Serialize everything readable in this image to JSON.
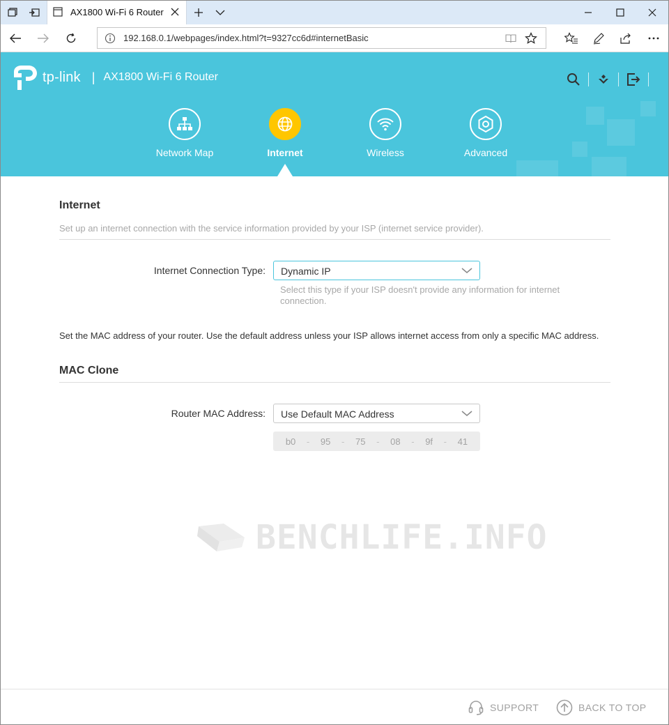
{
  "browser": {
    "tab_title": "AX1800 Wi-Fi 6 Router",
    "url": "192.168.0.1/webpages/index.html?t=9327cc6d#internetBasic"
  },
  "header": {
    "brand": "tp-link",
    "separator": "|",
    "model": "AX1800 Wi-Fi 6 Router",
    "accent_color": "#4ac5dc",
    "active_color": "#ffc600"
  },
  "nav": {
    "items": [
      {
        "label": "Network Map",
        "icon": "network-map-icon"
      },
      {
        "label": "Internet",
        "icon": "globe-icon",
        "active": true
      },
      {
        "label": "Wireless",
        "icon": "wifi-icon"
      },
      {
        "label": "Advanced",
        "icon": "gear-icon"
      }
    ]
  },
  "internet": {
    "title": "Internet",
    "description": "Set up an internet connection with the service information provided by your ISP (internet service provider).",
    "connection_type_label": "Internet Connection Type:",
    "connection_type_value": "Dynamic IP",
    "connection_type_hint": "Select this type if your ISP doesn't provide any information for internet connection."
  },
  "mac_clone": {
    "intro": "Set the MAC address of your router. Use the default address unless your ISP allows internet access from only a specific MAC address.",
    "title": "MAC Clone",
    "router_mac_label": "Router MAC Address:",
    "router_mac_value": "Use Default MAC Address",
    "mac_parts": [
      "b0",
      "95",
      "75",
      "08",
      "9f",
      "41"
    ],
    "mac_separator": "-"
  },
  "watermark": "BENCHLIFE.INFO",
  "footer": {
    "support": "SUPPORT",
    "back_to_top": "BACK TO TOP"
  }
}
